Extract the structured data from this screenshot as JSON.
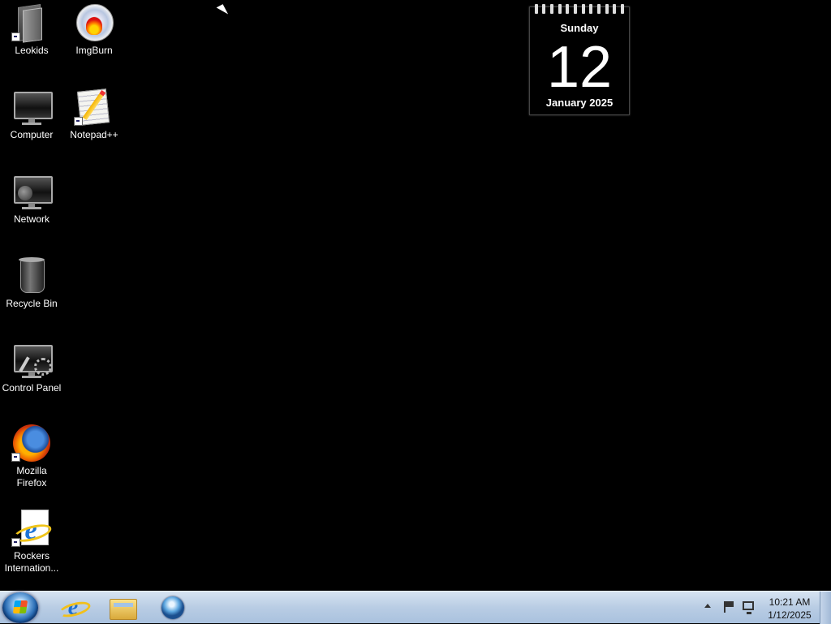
{
  "desktop": {
    "icons": [
      {
        "label": "Leokids"
      },
      {
        "label": "ImgBurn"
      },
      {
        "label": "Computer"
      },
      {
        "label": "Notepad++"
      },
      {
        "label": "Network"
      },
      {
        "label": "Recycle Bin"
      },
      {
        "label": "Control Panel"
      },
      {
        "label": "Mozilla Firefox"
      },
      {
        "label": "Rockers Internation..."
      }
    ]
  },
  "calendar_gadget": {
    "day_name": "Sunday",
    "date": "12",
    "month_year": "January 2025"
  },
  "taskbar": {
    "pinned": [
      "internet-explorer-icon",
      "windows-explorer-icon",
      "media-orb-icon"
    ],
    "clock": {
      "time": "10:21 AM",
      "date": "1/12/2025"
    }
  }
}
